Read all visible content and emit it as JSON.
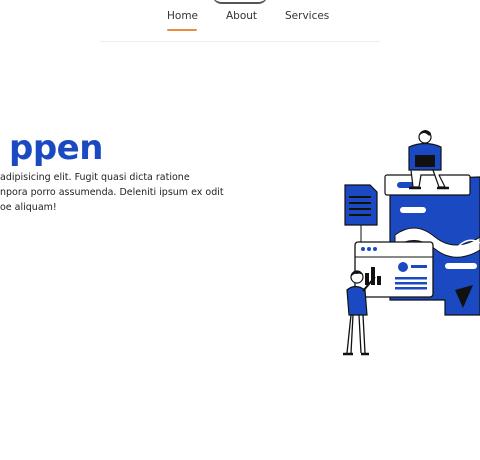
{
  "nav": {
    "items": [
      {
        "label": "Home",
        "active": true
      },
      {
        "label": "About",
        "active": false
      },
      {
        "label": "Services",
        "active": false
      }
    ],
    "accent_color": "#f08a3c"
  },
  "hero": {
    "title": "ppen",
    "lines": [
      " adipisicing elit. Fugit quasi dicta ratione",
      " npora porro assumenda. Deleniti ipsum ex odit",
      "oe aliquam!"
    ],
    "title_color": "#1a49c2",
    "illustration": "dashboard-team-illustration"
  }
}
